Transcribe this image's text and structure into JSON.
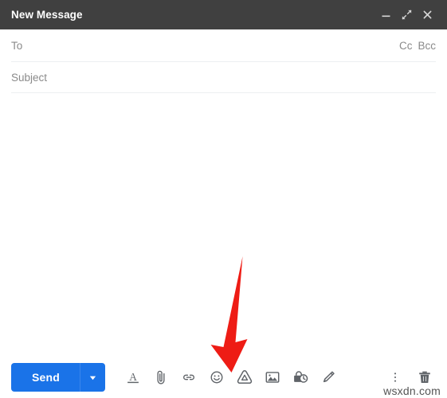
{
  "window": {
    "title": "New Message",
    "controls": [
      {
        "name": "minimize-button",
        "icon": "minimize-icon",
        "label": "Minimize"
      },
      {
        "name": "fullscreen-button",
        "icon": "fullscreen-icon",
        "label": "Full screen"
      },
      {
        "name": "close-button",
        "icon": "close-icon",
        "label": "Save & close"
      }
    ],
    "header_bg": "#404040",
    "title_color": "#ffffff"
  },
  "fields": {
    "to_placeholder": "To",
    "cc_label": "Cc",
    "bcc_label": "Bcc",
    "subject_placeholder": "Subject",
    "to_value": "",
    "subject_value": "",
    "body_value": "",
    "placeholder_color": "#8a8a8a"
  },
  "toolbar": {
    "send_label": "Send",
    "send_bg": "#1a73e8",
    "send_dropdown_icon": "chevron-down-icon",
    "icon_color": "#5f6368",
    "items": [
      {
        "name": "formatting-options-icon",
        "label": "Formatting options"
      },
      {
        "name": "attach-file-icon",
        "label": "Attach files"
      },
      {
        "name": "insert-link-icon",
        "label": "Insert link"
      },
      {
        "name": "insert-emoji-icon",
        "label": "Insert emoji"
      },
      {
        "name": "insert-drive-file-icon",
        "label": "Insert files using Drive"
      },
      {
        "name": "insert-photo-icon",
        "label": "Insert photo"
      },
      {
        "name": "confidential-mode-icon",
        "label": "Toggle confidential mode"
      },
      {
        "name": "insert-signature-icon",
        "label": "Insert signature"
      }
    ],
    "right_items": [
      {
        "name": "more-options-icon",
        "label": "More options"
      },
      {
        "name": "discard-draft-icon",
        "label": "Discard draft"
      }
    ]
  },
  "annotation": {
    "arrow_color": "#ee1c15",
    "points_to": "insert-drive-file-icon",
    "direction": "down"
  },
  "watermark": {
    "text": "wsxdn.com"
  }
}
